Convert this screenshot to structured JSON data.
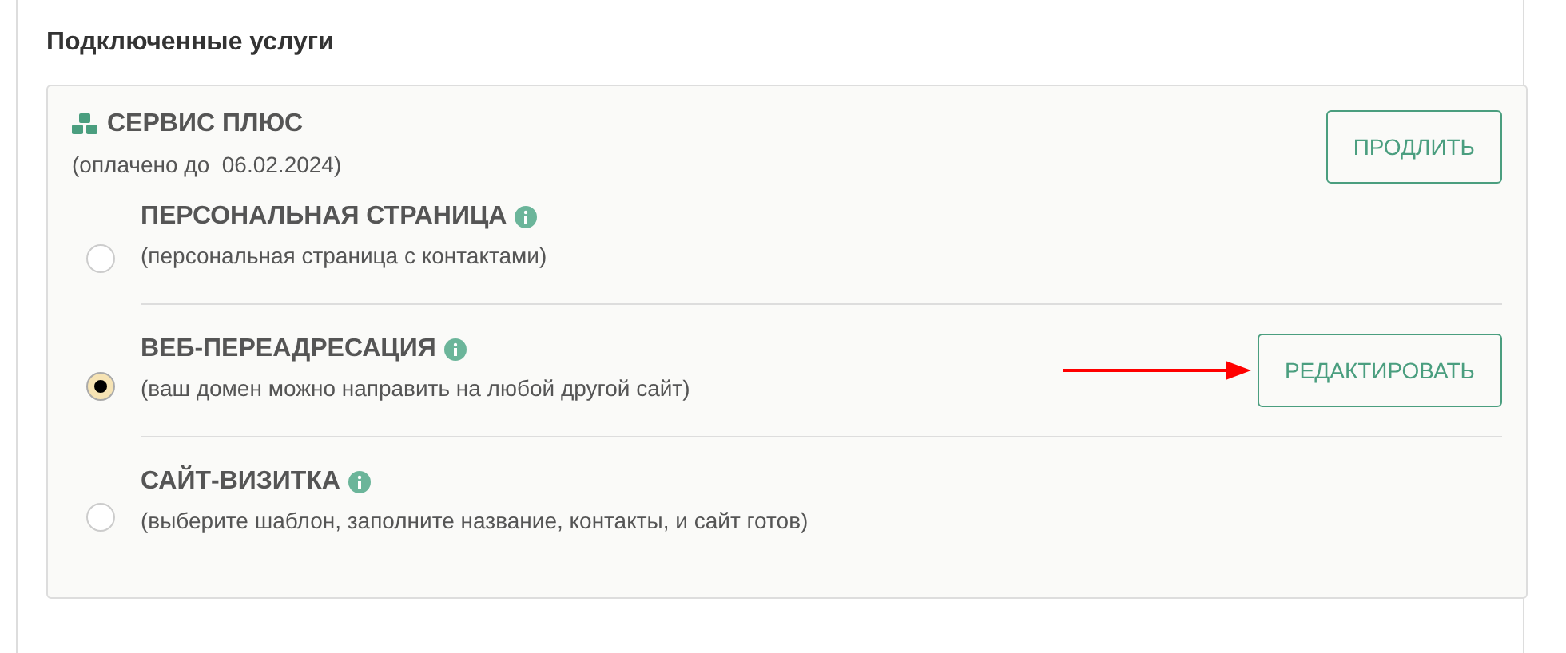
{
  "heading": "Подключенные услуги",
  "service": {
    "title": "СЕРВИС ПЛЮС",
    "paid_until": "(оплачено до  06.02.2024)",
    "button": "ПРОДЛИТЬ"
  },
  "options": [
    {
      "title": "ПЕРСОНАЛЬНАЯ СТРАНИЦА",
      "description": "(персональная страница с контактами)",
      "selected": false,
      "pointed_at": false
    },
    {
      "title": "ВЕБ-ПЕРЕАДРЕСАЦИЯ",
      "description": "(ваш домен можно направить на любой другой сайт)",
      "selected": true,
      "button": "РЕДАКТИРОВАТЬ",
      "pointed_at": true
    },
    {
      "title": "САЙТ-ВИЗИТКА",
      "description": "(выберите шаблон, заполните название, контакты, и сайт готов)",
      "selected": false,
      "pointed_at": false
    }
  ]
}
